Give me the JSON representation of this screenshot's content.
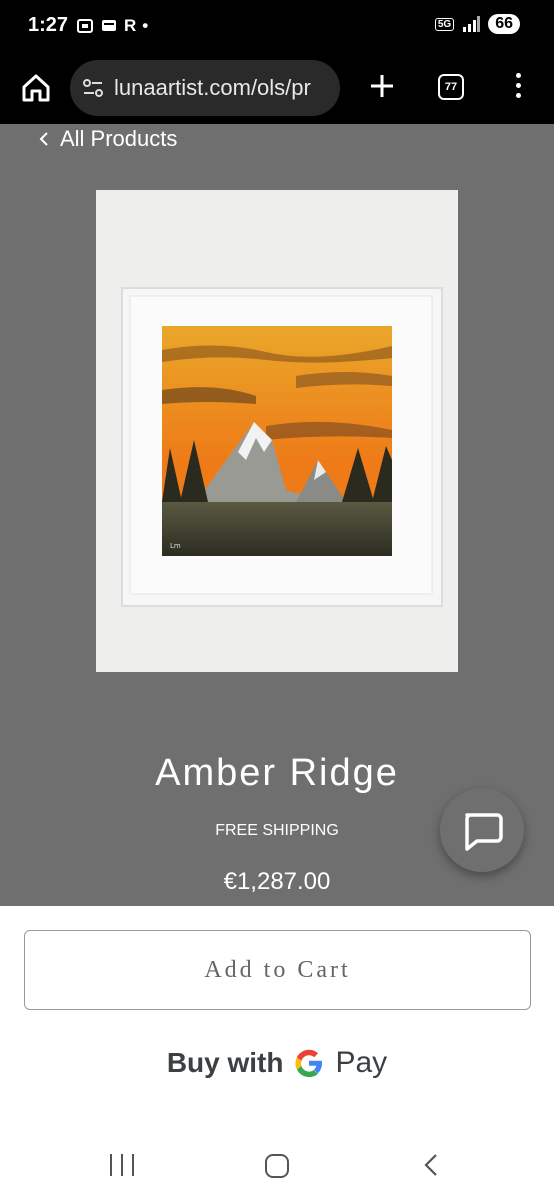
{
  "status": {
    "time": "1:27",
    "carrier_letter": "R",
    "network": "5G",
    "battery": "66"
  },
  "browser": {
    "url": "lunaartist.com/ols/pr",
    "tab_count": "77"
  },
  "product": {
    "back_label": "All Products",
    "title": "Amber Ridge",
    "shipping": "FREE SHIPPING",
    "price": "€1,287.00"
  },
  "actions": {
    "add_to_cart": "Add to Cart",
    "buy_with": "Buy with",
    "pay": "Pay"
  }
}
